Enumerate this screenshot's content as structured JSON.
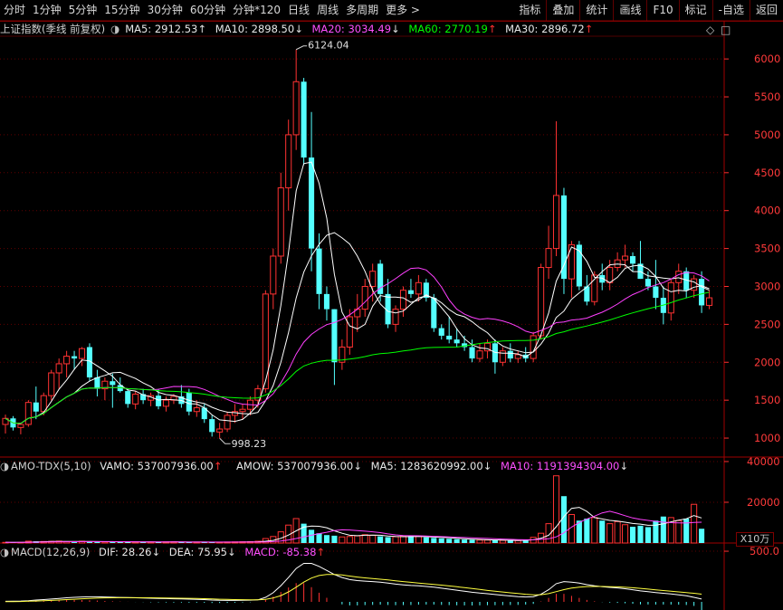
{
  "toolbar": {
    "periods": [
      "分时",
      "1分钟",
      "5分钟",
      "15分钟",
      "30分钟",
      "60分钟",
      "分钟*120",
      "日线",
      "周线",
      "多周期",
      "更多 >"
    ],
    "tools": [
      "指标",
      "叠加",
      "统计",
      "画线",
      "F10",
      "标记",
      "-自选",
      "返回"
    ]
  },
  "main_legend": {
    "title": "上证指数(季线 前复权)",
    "ma5": "MA5: 2912.53",
    "ma10": "MA10: 2898.50",
    "ma20": "MA20: 3034.49",
    "ma60": "MA60: 2770.19",
    "ma30": "MA30: 2896.72",
    "ma5_arrow": "↑",
    "ma10_arrow": "↓",
    "ma20_arrow": "↓",
    "ma60_arrow": "↑",
    "ma30_arrow": "↑"
  },
  "volume_legend": {
    "title": "AMO-TDX(5,10)",
    "vamo": "VAMO: 537007936.00",
    "amow": "AMOW: 537007936.00",
    "ma5": "MA5: 1283620992.00",
    "ma10": "MA10: 1191394304.00",
    "vamo_arrow": "↑",
    "amow_arrow": "↓",
    "ma5_arrow": "↓",
    "ma10_arrow": "↓",
    "unit": "X10万"
  },
  "macd_legend": {
    "title": "MACD(12,26,9)",
    "dif": "DIF: 28.26",
    "dea": "DEA: 75.95",
    "macd": "MACD: -85.38",
    "dif_arrow": "↓",
    "dea_arrow": "↓",
    "macd_arrow": "↑"
  },
  "chart_data": {
    "type": "candlestick",
    "price_axis": [
      "6000",
      "5500",
      "5000",
      "4500",
      "4000",
      "3500",
      "3000",
      "2500",
      "2000",
      "1500",
      "1000"
    ],
    "price_range": [
      750,
      6300
    ],
    "volume_axis": [
      "40000",
      "20000"
    ],
    "macd_axis": [
      "500.0"
    ],
    "high_annotation": "6124.04",
    "low_annotation": "998.23",
    "colors": {
      "up": "#ff3232",
      "down": "#54ffff",
      "ma5": "#ffffff",
      "ma10": "#ffffff",
      "ma20": "#ff40ff",
      "ma60": "#00ff00",
      "ma30": "#ffff40",
      "grid": "#600000",
      "axis_text": "#ff3a3a"
    },
    "candles": [
      {
        "o": 1180,
        "h": 1310,
        "l": 1060,
        "c": 1260
      },
      {
        "o": 1260,
        "h": 1290,
        "l": 1100,
        "c": 1140
      },
      {
        "o": 1140,
        "h": 1200,
        "l": 1050,
        "c": 1180
      },
      {
        "o": 1180,
        "h": 1500,
        "l": 1150,
        "c": 1470
      },
      {
        "o": 1470,
        "h": 1680,
        "l": 1250,
        "c": 1350
      },
      {
        "o": 1350,
        "h": 1600,
        "l": 1300,
        "c": 1560
      },
      {
        "o": 1560,
        "h": 1900,
        "l": 1500,
        "c": 1860
      },
      {
        "o": 1860,
        "h": 2050,
        "l": 1650,
        "c": 1980
      },
      {
        "o": 1980,
        "h": 2150,
        "l": 1800,
        "c": 2080
      },
      {
        "o": 2080,
        "h": 2150,
        "l": 1900,
        "c": 2050
      },
      {
        "o": 2050,
        "h": 2200,
        "l": 1950,
        "c": 2180
      },
      {
        "o": 2200,
        "h": 2250,
        "l": 1750,
        "c": 1800
      },
      {
        "o": 1800,
        "h": 1900,
        "l": 1550,
        "c": 1650
      },
      {
        "o": 1650,
        "h": 1800,
        "l": 1500,
        "c": 1750
      },
      {
        "o": 1750,
        "h": 1850,
        "l": 1400,
        "c": 1700
      },
      {
        "o": 1700,
        "h": 1800,
        "l": 1600,
        "c": 1620
      },
      {
        "o": 1620,
        "h": 1650,
        "l": 1400,
        "c": 1450
      },
      {
        "o": 1450,
        "h": 1620,
        "l": 1380,
        "c": 1580
      },
      {
        "o": 1580,
        "h": 1650,
        "l": 1450,
        "c": 1500
      },
      {
        "o": 1500,
        "h": 1600,
        "l": 1420,
        "c": 1560
      },
      {
        "o": 1560,
        "h": 1650,
        "l": 1380,
        "c": 1420
      },
      {
        "o": 1420,
        "h": 1550,
        "l": 1350,
        "c": 1500
      },
      {
        "o": 1500,
        "h": 1580,
        "l": 1450,
        "c": 1550
      },
      {
        "o": 1550,
        "h": 1700,
        "l": 1400,
        "c": 1450
      },
      {
        "o": 1600,
        "h": 1650,
        "l": 1300,
        "c": 1350
      },
      {
        "o": 1350,
        "h": 1500,
        "l": 1280,
        "c": 1400
      },
      {
        "o": 1400,
        "h": 1450,
        "l": 1200,
        "c": 1250
      },
      {
        "o": 1250,
        "h": 1300,
        "l": 1020,
        "c": 1080
      },
      {
        "o": 1080,
        "h": 1200,
        "l": 998,
        "c": 1120
      },
      {
        "o": 1120,
        "h": 1350,
        "l": 1080,
        "c": 1300
      },
      {
        "o": 1300,
        "h": 1450,
        "l": 1200,
        "c": 1350
      },
      {
        "o": 1350,
        "h": 1450,
        "l": 1250,
        "c": 1380
      },
      {
        "o": 1380,
        "h": 1550,
        "l": 1300,
        "c": 1500
      },
      {
        "o": 1500,
        "h": 1700,
        "l": 1400,
        "c": 1650
      },
      {
        "o": 1650,
        "h": 2950,
        "l": 1600,
        "c": 2900
      },
      {
        "o": 2900,
        "h": 3500,
        "l": 2700,
        "c": 3400
      },
      {
        "o": 3400,
        "h": 4500,
        "l": 3300,
        "c": 4300
      },
      {
        "o": 4300,
        "h": 5200,
        "l": 4000,
        "c": 5000
      },
      {
        "o": 5000,
        "h": 6124,
        "l": 4800,
        "c": 5700
      },
      {
        "o": 5700,
        "h": 5750,
        "l": 4600,
        "c": 4700
      },
      {
        "o": 4700,
        "h": 5300,
        "l": 3200,
        "c": 3500
      },
      {
        "o": 3500,
        "h": 3700,
        "l": 2700,
        "c": 2900
      },
      {
        "o": 2900,
        "h": 3000,
        "l": 2550,
        "c": 2700
      },
      {
        "o": 2700,
        "h": 2700,
        "l": 1700,
        "c": 2000
      },
      {
        "o": 2000,
        "h": 2300,
        "l": 1900,
        "c": 2200
      },
      {
        "o": 2200,
        "h": 2700,
        "l": 2100,
        "c": 2600
      },
      {
        "o": 2600,
        "h": 2900,
        "l": 2400,
        "c": 2700
      },
      {
        "o": 2700,
        "h": 3100,
        "l": 2600,
        "c": 3000
      },
      {
        "o": 3000,
        "h": 3300,
        "l": 2800,
        "c": 3200
      },
      {
        "o": 3300,
        "h": 3350,
        "l": 2800,
        "c": 2900
      },
      {
        "o": 2900,
        "h": 3100,
        "l": 2450,
        "c": 2500
      },
      {
        "o": 2500,
        "h": 2750,
        "l": 2400,
        "c": 2700
      },
      {
        "o": 2700,
        "h": 3000,
        "l": 2600,
        "c": 2950
      },
      {
        "o": 2950,
        "h": 3100,
        "l": 2850,
        "c": 2900
      },
      {
        "o": 2900,
        "h": 3150,
        "l": 2800,
        "c": 3050
      },
      {
        "o": 3050,
        "h": 3100,
        "l": 2800,
        "c": 2850
      },
      {
        "o": 2850,
        "h": 2900,
        "l": 2400,
        "c": 2450
      },
      {
        "o": 2450,
        "h": 2500,
        "l": 2300,
        "c": 2350
      },
      {
        "o": 2350,
        "h": 2600,
        "l": 2250,
        "c": 2300
      },
      {
        "o": 2300,
        "h": 2450,
        "l": 2200,
        "c": 2250
      },
      {
        "o": 2250,
        "h": 2350,
        "l": 2150,
        "c": 2200
      },
      {
        "o": 2200,
        "h": 2300,
        "l": 2000,
        "c": 2050
      },
      {
        "o": 2050,
        "h": 2250,
        "l": 2000,
        "c": 2150
      },
      {
        "o": 2150,
        "h": 2300,
        "l": 2050,
        "c": 2250
      },
      {
        "o": 2250,
        "h": 2300,
        "l": 1850,
        "c": 2000
      },
      {
        "o": 2000,
        "h": 2200,
        "l": 1950,
        "c": 2150
      },
      {
        "o": 2150,
        "h": 2250,
        "l": 2000,
        "c": 2050
      },
      {
        "o": 2050,
        "h": 2150,
        "l": 1990,
        "c": 2100
      },
      {
        "o": 2100,
        "h": 2200,
        "l": 2000,
        "c": 2050
      },
      {
        "o": 2050,
        "h": 2400,
        "l": 2000,
        "c": 2350
      },
      {
        "o": 2350,
        "h": 3300,
        "l": 2300,
        "c": 3250
      },
      {
        "o": 3250,
        "h": 3800,
        "l": 3100,
        "c": 3500
      },
      {
        "o": 3500,
        "h": 5178,
        "l": 3400,
        "c": 4200
      },
      {
        "o": 4200,
        "h": 4300,
        "l": 2900,
        "c": 3100
      },
      {
        "o": 3100,
        "h": 3600,
        "l": 2850,
        "c": 3550
      },
      {
        "o": 3550,
        "h": 3600,
        "l": 2950,
        "c": 3000
      },
      {
        "o": 3000,
        "h": 3150,
        "l": 2750,
        "c": 2800
      },
      {
        "o": 2800,
        "h": 3200,
        "l": 2750,
        "c": 3150
      },
      {
        "o": 3150,
        "h": 3300,
        "l": 2950,
        "c": 3050
      },
      {
        "o": 3050,
        "h": 3350,
        "l": 2950,
        "c": 3250
      },
      {
        "o": 3250,
        "h": 3450,
        "l": 3200,
        "c": 3350
      },
      {
        "o": 3350,
        "h": 3550,
        "l": 3250,
        "c": 3400
      },
      {
        "o": 3400,
        "h": 3450,
        "l": 3200,
        "c": 3300
      },
      {
        "o": 3300,
        "h": 3600,
        "l": 3100,
        "c": 3100
      },
      {
        "o": 3100,
        "h": 3200,
        "l": 2950,
        "c": 3000
      },
      {
        "o": 3000,
        "h": 3350,
        "l": 2700,
        "c": 2850
      },
      {
        "o": 2850,
        "h": 3000,
        "l": 2500,
        "c": 2650
      },
      {
        "o": 2650,
        "h": 3100,
        "l": 2550,
        "c": 3050
      },
      {
        "o": 3050,
        "h": 3300,
        "l": 2900,
        "c": 3200
      },
      {
        "o": 3200,
        "h": 3250,
        "l": 2850,
        "c": 2950
      },
      {
        "o": 2950,
        "h": 3150,
        "l": 2850,
        "c": 3100
      },
      {
        "o": 3100,
        "h": 3200,
        "l": 2650,
        "c": 2750
      },
      {
        "o": 2750,
        "h": 2950,
        "l": 2700,
        "c": 2850
      }
    ],
    "volume": [
      320,
      250,
      280,
      900,
      850,
      760,
      820,
      950,
      700,
      640,
      880,
      760,
      620,
      540,
      580,
      520,
      460,
      550,
      480,
      520,
      490,
      560,
      600,
      520,
      430,
      480,
      440,
      380,
      420,
      500,
      560,
      620,
      700,
      900,
      2200,
      3200,
      5500,
      8800,
      12000,
      9500,
      6500,
      4800,
      3900,
      3600,
      3000,
      3200,
      3500,
      4100,
      3800,
      3300,
      2900,
      3100,
      3300,
      3500,
      3400,
      2800,
      2500,
      2300,
      2100,
      1900,
      1700,
      1600,
      1500,
      1450,
      1350,
      1300,
      1250,
      1200,
      1600,
      2800,
      4800,
      9500,
      33000,
      23000,
      14000,
      11000,
      12000,
      12500,
      11000,
      9500,
      10500,
      9000,
      8000,
      8500,
      7800,
      11000,
      13000,
      12500,
      11000,
      12000,
      19000,
      7000
    ],
    "volume_ma5": [
      300,
      290,
      300,
      420,
      520,
      640,
      750,
      820,
      800,
      760,
      780,
      780,
      730,
      680,
      660,
      600,
      560,
      550,
      530,
      520,
      500,
      510,
      530,
      530,
      510,
      500,
      480,
      450,
      430,
      440,
      450,
      480,
      520,
      600,
      900,
      1300,
      2300,
      3900,
      6000,
      7800,
      8300,
      8200,
      7500,
      6000,
      4800,
      3800,
      3600,
      3800,
      3900,
      3800,
      3400,
      3200,
      3100,
      3100,
      3200,
      3100,
      2950,
      2800,
      2600,
      2300,
      2100,
      1900,
      1750,
      1600,
      1500,
      1400,
      1350,
      1300,
      1350,
      1600,
      2300,
      3800,
      8000,
      13000,
      17000,
      17500,
      15500,
      12500,
      11800,
      11100,
      10800,
      10200,
      9600,
      9300,
      8700,
      8800,
      9400,
      10400,
      11200,
      11900,
      13500,
      12300
    ],
    "volume_ma10": [
      300,
      300,
      300,
      360,
      420,
      480,
      540,
      600,
      640,
      650,
      670,
      700,
      710,
      700,
      690,
      680,
      650,
      620,
      590,
      570,
      550,
      540,
      530,
      520,
      510,
      505,
      500,
      490,
      480,
      480,
      480,
      480,
      480,
      490,
      540,
      700,
      1000,
      1500,
      2200,
      3000,
      3800,
      4600,
      5300,
      6100,
      6500,
      6400,
      6100,
      5800,
      5500,
      5100,
      4500,
      4000,
      3700,
      3600,
      3550,
      3450,
      3300,
      3150,
      3000,
      2850,
      2700,
      2550,
      2400,
      2250,
      2100,
      1950,
      1800,
      1700,
      1600,
      1600,
      1800,
      2100,
      3000,
      5000,
      7800,
      10100,
      11800,
      13200,
      14800,
      15600,
      14600,
      13400,
      12300,
      11600,
      11100,
      10600,
      10200,
      10000,
      9900,
      9800,
      10100,
      10200
    ],
    "macd_dif": [
      5,
      6,
      8,
      12,
      18,
      22,
      28,
      34,
      40,
      45,
      48,
      50,
      50,
      48,
      46,
      44,
      42,
      40,
      38,
      36,
      34,
      32,
      30,
      29,
      27,
      25,
      22,
      18,
      15,
      14,
      14,
      15,
      17,
      20,
      45,
      90,
      160,
      240,
      330,
      380,
      380,
      350,
      310,
      270,
      240,
      220,
      210,
      205,
      200,
      195,
      185,
      175,
      168,
      162,
      158,
      152,
      145,
      135,
      125,
      115,
      105,
      95,
      87,
      80,
      72,
      65,
      58,
      52,
      48,
      50,
      75,
      120,
      180,
      200,
      195,
      185,
      170,
      158,
      150,
      143,
      138,
      130,
      120,
      108,
      100,
      92,
      85,
      78,
      70,
      60,
      45,
      28
    ],
    "macd_dea": [
      2,
      3,
      4,
      6,
      8,
      11,
      14,
      18,
      22,
      26,
      30,
      34,
      37,
      39,
      40,
      41,
      41,
      41,
      40,
      40,
      39,
      38,
      37,
      36,
      35,
      33,
      31,
      29,
      26,
      24,
      22,
      21,
      20,
      20,
      25,
      38,
      62,
      98,
      145,
      195,
      235,
      260,
      270,
      270,
      265,
      255,
      245,
      237,
      230,
      223,
      216,
      208,
      200,
      193,
      186,
      179,
      172,
      165,
      157,
      149,
      140,
      131,
      122,
      113,
      105,
      97,
      89,
      82,
      75,
      70,
      71,
      81,
      101,
      121,
      136,
      146,
      151,
      152,
      152,
      150,
      148,
      144,
      139,
      133,
      126,
      119,
      112,
      105,
      98,
      91,
      85,
      75.95
    ],
    "macd_hist": [
      3,
      3,
      4,
      6,
      10,
      11,
      14,
      16,
      18,
      19,
      18,
      16,
      13,
      9,
      6,
      3,
      1,
      -1,
      -2,
      -4,
      -5,
      -6,
      -7,
      -7,
      -8,
      -8,
      -9,
      -11,
      -11,
      -10,
      -8,
      -6,
      -3,
      0,
      20,
      52,
      98,
      142,
      185,
      185,
      145,
      90,
      40,
      0,
      -25,
      -35,
      -35,
      -32,
      -30,
      -28,
      -31,
      -33,
      -32,
      -31,
      -28,
      -27,
      -27,
      -30,
      -32,
      -34,
      -35,
      -36,
      -35,
      -33,
      -33,
      -32,
      -31,
      -30,
      -27,
      -20,
      4,
      39,
      79,
      79,
      59,
      39,
      19,
      6,
      -2,
      -7,
      -10,
      -14,
      -19,
      -25,
      -26,
      -27,
      -27,
      -27,
      -28,
      -31,
      -40,
      -85.38
    ]
  }
}
